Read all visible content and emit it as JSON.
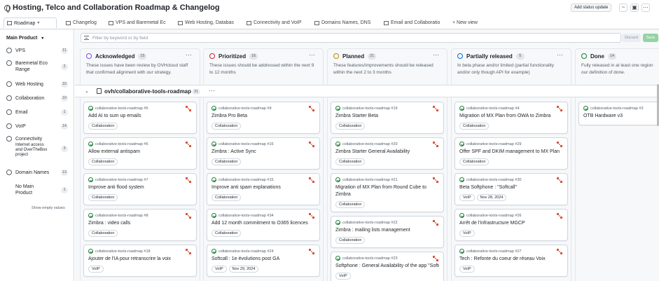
{
  "header": {
    "title": "Hosting, Telco and Collaboration Roadmap & Changelog",
    "status_button": "Add status update",
    "icons": [
      "chart-icon",
      "layout-icon",
      "more-icon"
    ]
  },
  "tabs": [
    {
      "label": "Roadmap",
      "active": true
    },
    {
      "label": "Changelog"
    },
    {
      "label": "VPS and Baremetal Eco"
    },
    {
      "label": "Web Hosting, Databas"
    },
    {
      "label": "Connectivity and VoIP"
    },
    {
      "label": "Domains Names, DNS"
    },
    {
      "label": "Email and Collaboratio"
    }
  ],
  "new_view": "+ New view",
  "sidebar": {
    "heading": "Main Product",
    "items": [
      {
        "label": "VPS",
        "count": "11"
      },
      {
        "label": "Baremetal Eco Range",
        "count": "2"
      },
      {
        "label": "Web Hosting",
        "count": "10"
      },
      {
        "label": "Collaboration",
        "count": "10"
      },
      {
        "label": "Email",
        "count": "1"
      },
      {
        "label": "VoIP",
        "count": "14"
      },
      {
        "label": "Connectivity",
        "sublabel": "Internet access and OverTheBox project",
        "count": "3"
      },
      {
        "label": "Domain Names",
        "count": "13"
      },
      {
        "label": "No Main Product",
        "count": "1"
      }
    ],
    "show_empty": "Show empty values"
  },
  "filter": {
    "placeholder": "Filter by keyword or by field",
    "discard": "Discard",
    "save": "Save"
  },
  "columns": [
    {
      "name": "Acknowledged",
      "count": "15",
      "color": "#8250df",
      "desc1": "These issues have been review by OVHcloud staff",
      "desc2": "that confirmed alignment with our strategy."
    },
    {
      "name": "Prioritized",
      "count": "16",
      "color": "#cf222e",
      "desc1": "These issues should be addressed within the next 9",
      "desc2": "to 12 months"
    },
    {
      "name": "Planned",
      "count": "21",
      "color": "#bf8700",
      "desc1": "These features/improvements should be released",
      "desc2": "within the next 2 to 3 months"
    },
    {
      "name": "Partially released",
      "count": "5",
      "color": "#0969da",
      "desc1": "In beta phase and/or limited (partial functionality",
      "desc2": "and/or only though API for example)"
    },
    {
      "name": "Done",
      "count": "14",
      "color": "#1a7f37",
      "desc1": "Fully released in at least one region",
      "desc2": "our definition of done."
    }
  ],
  "group": {
    "name": "ovh/collaborative-tools-roadmap",
    "count": "31"
  },
  "cards": {
    "col0": [
      {
        "ref": "collaborative-tools-roadmap #5",
        "title": "Add AI to sum up emails",
        "labels": [
          "Collaboration"
        ]
      },
      {
        "ref": "collaborative-tools-roadmap #6",
        "title": "Allow external antispam",
        "labels": [
          "Collaboration"
        ]
      },
      {
        "ref": "collaborative-tools-roadmap #7",
        "title": "Improve anti flood system",
        "labels": [
          "Collaboration"
        ]
      },
      {
        "ref": "collaborative-tools-roadmap #8",
        "title": "Zimbra : video calls",
        "labels": [
          "Collaboration"
        ]
      },
      {
        "ref": "collaborative-tools-roadmap #18",
        "title": "Ajouter de l'IA pour retranscrire la voix",
        "labels": [
          "VoIP"
        ]
      }
    ],
    "col1": [
      {
        "ref": "collaborative-tools-roadmap #9",
        "title": "Zimbra Pro Beta",
        "labels": [
          "Collaboration"
        ]
      },
      {
        "ref": "collaborative-tools-roadmap #16",
        "title": "Zimbra : Active Sync",
        "labels": [
          "Collaboration"
        ]
      },
      {
        "ref": "collaborative-tools-roadmap #15",
        "title": "Improve anti spam explanations",
        "labels": [
          "Collaboration"
        ]
      },
      {
        "ref": "collaborative-tools-roadmap #34",
        "title": "Add 12 month commitment to O365 licences",
        "labels": [
          "Collaboration"
        ]
      },
      {
        "ref": "collaborative-tools-roadmap #24",
        "title": "Softcall : 1e évolutions post GA",
        "labels": [
          "VoIP",
          "Nov 29, 2024"
        ]
      }
    ],
    "col2": [
      {
        "ref": "collaborative-tools-roadmap #19",
        "title": "Zimbra Starter Beta",
        "labels": [
          "Collaboration"
        ]
      },
      {
        "ref": "collaborative-tools-roadmap #20",
        "title": "Zimbra Starter General Availability",
        "labels": [
          "Collaboration"
        ]
      },
      {
        "ref": "collaborative-tools-roadmap #21",
        "title": "Migration of MX Plan from Round Cube to Zimbra",
        "labels": [
          "Collaboration"
        ]
      },
      {
        "ref": "collaborative-tools-roadmap #22",
        "title": "Zimbra : mailing lists management",
        "labels": [
          "Collaboration"
        ]
      },
      {
        "ref": "collaborative-tools-roadmap #23",
        "title": "Softphone : General Availability of the app \"Softcall\"",
        "labels": [
          "VoIP"
        ]
      }
    ],
    "col3": [
      {
        "ref": "collaborative-tools-roadmap #4",
        "title": "Migration of MX Plan from OWA to Zimbra",
        "labels": [
          "Collaboration"
        ]
      },
      {
        "ref": "collaborative-tools-roadmap #29",
        "title": "Offer SPF and DKIM management to MX Plan",
        "labels": [
          "Collaboration"
        ]
      },
      {
        "ref": "collaborative-tools-roadmap #30",
        "title": "Beta Softphone : \"Softcall\"",
        "labels": [
          "VoIP",
          "Nov 28, 2024"
        ]
      },
      {
        "ref": "collaborative-tools-roadmap #26",
        "title": "Arrêt de l'infrastructure MGCP",
        "labels": [
          "VoIP"
        ]
      },
      {
        "ref": "collaborative-tools-roadmap #27",
        "title": "Tech : Refonte du coeur de réseau Voix",
        "labels": [
          "VoIP"
        ]
      }
    ],
    "col4": [
      {
        "ref": "collaborative-tools-roadmap #3",
        "title": "OTB Hardware v3",
        "labels": []
      }
    ]
  }
}
